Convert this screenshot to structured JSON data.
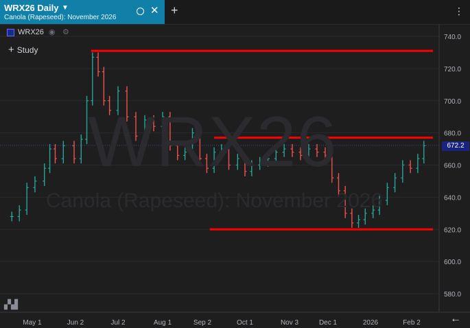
{
  "tab": {
    "title": "WRX26 Daily",
    "subtitle": "Canola (Rapeseed): November 2026",
    "add_label": "+",
    "menu_label": "⋮"
  },
  "legend": {
    "symbol": "WRX26",
    "study_label": "Study",
    "eye_icon": "eye-icon",
    "gear_icon": "gear-icon"
  },
  "watermark": {
    "symbol": "WRX26",
    "name": "Canola (Rapeseed): November 2026"
  },
  "price_tag": "672.2",
  "colors": {
    "up": "#26a69a",
    "down": "#ef5350",
    "line": "#ff0000",
    "tab": "#1180a8"
  },
  "chart_data": {
    "type": "ohlc",
    "x_labels": [
      "May 1",
      "Jun 2",
      "Jul 2",
      "Aug 1",
      "Sep 2",
      "Oct 1",
      "Nov 3",
      "Dec 1",
      "2026",
      "Feb 2"
    ],
    "y_ticks": [
      "740.0",
      "720.0",
      "700.0",
      "680.0",
      "660.0",
      "640.0",
      "620.0",
      "600.0",
      "580.0"
    ],
    "ylim": [
      569,
      748
    ],
    "last_price": 672.2,
    "horizontal_lines": [
      {
        "price": 731,
        "from": "Jun 13",
        "to": "Feb 16"
      },
      {
        "price": 677,
        "from": "Sep 10",
        "to": "Feb 16"
      },
      {
        "price": 620,
        "from": "Sep 7",
        "to": "Feb 16"
      }
    ],
    "series": [
      {
        "date": "Apr 12",
        "value": 628
      },
      {
        "date": "Apr 19",
        "value": 632
      },
      {
        "date": "Apr 26",
        "value": 646
      },
      {
        "date": "May 3",
        "value": 650
      },
      {
        "date": "May 10",
        "value": 658
      },
      {
        "date": "May 14",
        "value": 670
      },
      {
        "date": "May 18",
        "value": 664
      },
      {
        "date": "May 24",
        "value": 672
      },
      {
        "date": "Jun 1",
        "value": 664
      },
      {
        "date": "Jun 6",
        "value": 676
      },
      {
        "date": "Jun 10",
        "value": 700
      },
      {
        "date": "Jun 14",
        "value": 727
      },
      {
        "date": "Jun 18",
        "value": 718
      },
      {
        "date": "Jun 22",
        "value": 700
      },
      {
        "date": "Jun 26",
        "value": 694
      },
      {
        "date": "Jul 2",
        "value": 706
      },
      {
        "date": "Jul 8",
        "value": 690
      },
      {
        "date": "Jul 14",
        "value": 678
      },
      {
        "date": "Jul 20",
        "value": 688
      },
      {
        "date": "Jul 26",
        "value": 684
      },
      {
        "date": "Aug 1",
        "value": 690
      },
      {
        "date": "Aug 7",
        "value": 672
      },
      {
        "date": "Aug 13",
        "value": 666
      },
      {
        "date": "Aug 19",
        "value": 668
      },
      {
        "date": "Aug 25",
        "value": 680
      },
      {
        "date": "Aug 31",
        "value": 664
      },
      {
        "date": "Sep 5",
        "value": 658
      },
      {
        "date": "Sep 10",
        "value": 668
      },
      {
        "date": "Sep 15",
        "value": 670
      },
      {
        "date": "Sep 20",
        "value": 660
      },
      {
        "date": "Sep 26",
        "value": 664
      },
      {
        "date": "Oct 1",
        "value": 656
      },
      {
        "date": "Oct 6",
        "value": 660
      },
      {
        "date": "Oct 12",
        "value": 662
      },
      {
        "date": "Oct 18",
        "value": 664
      },
      {
        "date": "Oct 24",
        "value": 668
      },
      {
        "date": "Oct 30",
        "value": 670
      },
      {
        "date": "Nov 5",
        "value": 668
      },
      {
        "date": "Nov 11",
        "value": 666
      },
      {
        "date": "Nov 17",
        "value": 670
      },
      {
        "date": "Nov 23",
        "value": 668
      },
      {
        "date": "Nov 29",
        "value": 666
      },
      {
        "date": "Dec 4",
        "value": 652
      },
      {
        "date": "Dec 9",
        "value": 644
      },
      {
        "date": "Dec 14",
        "value": 630
      },
      {
        "date": "Dec 19",
        "value": 624
      },
      {
        "date": "Dec 24",
        "value": 626
      },
      {
        "date": "Dec 29",
        "value": 630
      },
      {
        "date": "Jan 3",
        "value": 632
      },
      {
        "date": "Jan 8",
        "value": 638
      },
      {
        "date": "Jan 14",
        "value": 646
      },
      {
        "date": "Jan 20",
        "value": 652
      },
      {
        "date": "Jan 26",
        "value": 660
      },
      {
        "date": "Feb 1",
        "value": 658
      },
      {
        "date": "Feb 6",
        "value": 664
      },
      {
        "date": "Feb 10",
        "value": 672
      }
    ]
  }
}
